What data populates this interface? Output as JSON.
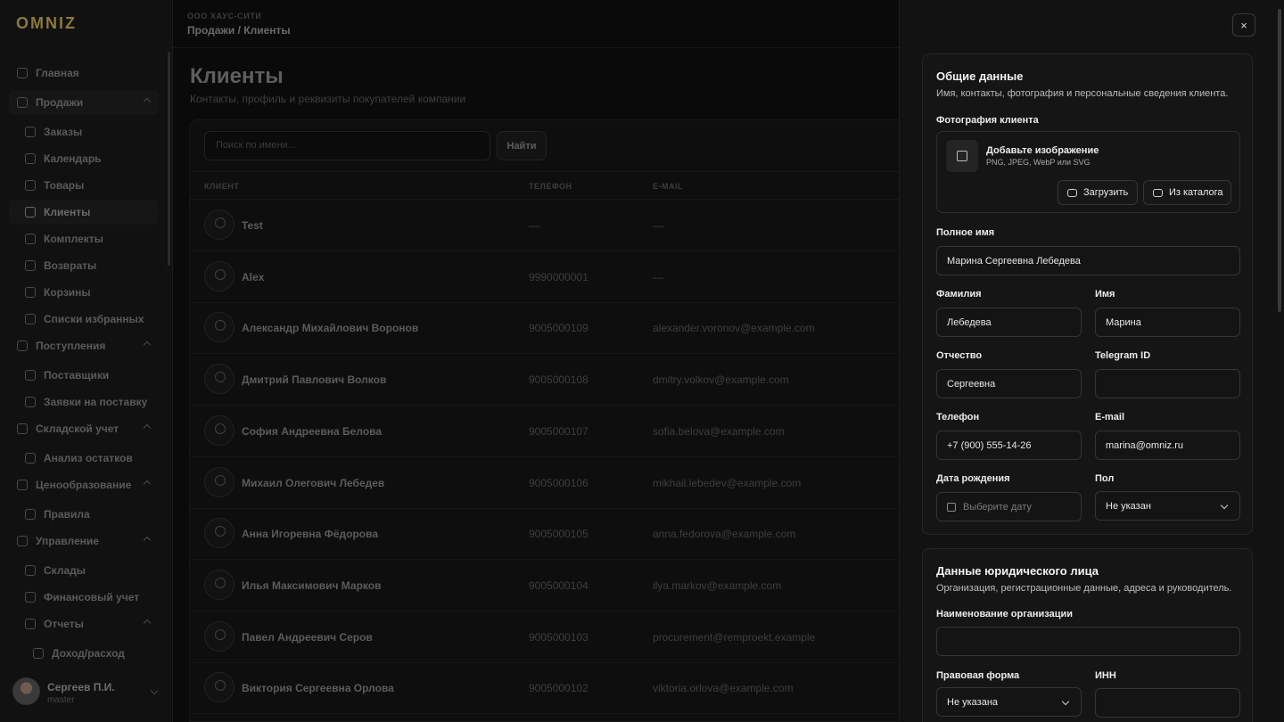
{
  "sidebar": {
    "logo": "OMNIZ",
    "items": [
      {
        "label": "Главная",
        "level": "top",
        "icon": "grid-icon"
      },
      {
        "label": "Продажи",
        "level": "top",
        "icon": "bag-icon",
        "expandable": true
      },
      {
        "label": "Заказы",
        "level": "sub",
        "icon": "clipboard-icon"
      },
      {
        "label": "Календарь",
        "level": "sub",
        "icon": "calendar-icon"
      },
      {
        "label": "Товары",
        "level": "sub",
        "icon": "box-icon"
      },
      {
        "label": "Клиенты",
        "level": "sub",
        "icon": "user-icon",
        "active": true
      },
      {
        "label": "Комплекты",
        "level": "sub",
        "icon": "layers-icon"
      },
      {
        "label": "Возвраты",
        "level": "sub",
        "icon": "return-icon"
      },
      {
        "label": "Корзины",
        "level": "sub",
        "icon": "cart-icon"
      },
      {
        "label": "Списки избранных",
        "level": "sub",
        "icon": "heart-icon"
      },
      {
        "label": "Поступления",
        "level": "top",
        "icon": "package-icon",
        "expandable": true
      },
      {
        "label": "Поставщики",
        "level": "sub",
        "icon": "truck-icon"
      },
      {
        "label": "Заявки на поставку",
        "level": "sub",
        "icon": "inbox-icon"
      },
      {
        "label": "Складской учет",
        "level": "top",
        "icon": "warehouse-icon",
        "expandable": true
      },
      {
        "label": "Анализ остатков",
        "level": "sub",
        "icon": "chart-icon"
      },
      {
        "label": "Ценообразование",
        "level": "top",
        "icon": "tag-icon",
        "expandable": true
      },
      {
        "label": "Правила",
        "level": "sub",
        "icon": "tag-icon"
      },
      {
        "label": "Управление",
        "level": "top",
        "icon": "building-icon",
        "expandable": true
      },
      {
        "label": "Склады",
        "level": "sub",
        "icon": "folder-icon"
      },
      {
        "label": "Финансовый учет",
        "level": "sub",
        "icon": "wallet-icon"
      },
      {
        "label": "Отчеты",
        "level": "sub",
        "icon": "bar-chart-icon",
        "expandable": true
      },
      {
        "label": "Доход/расход",
        "level": "sub2",
        "icon": "receipt-icon"
      }
    ],
    "user": {
      "name": "Сергеев П.И.",
      "role": "master"
    }
  },
  "header": {
    "company": "ООО ХАУС-СИТИ",
    "breadcrumb": "Продажи / Клиенты"
  },
  "page": {
    "title": "Клиенты",
    "subtitle": "Контакты, профиль и реквизиты покупателей компании"
  },
  "search": {
    "placeholder": "Поиск по имени...",
    "button": "Найти"
  },
  "table": {
    "columns": [
      "КЛИЕНТ",
      "ТЕЛЕФОН",
      "E-MAIL"
    ],
    "rows": [
      {
        "name": "Test",
        "phone": "—",
        "email": "—"
      },
      {
        "name": "Alex",
        "phone": "9990000001",
        "email": "—"
      },
      {
        "name": "Александр Михайлович Воронов",
        "phone": "9005000109",
        "email": "alexander.voronov@example.com"
      },
      {
        "name": "Дмитрий Павлович Волков",
        "phone": "9005000108",
        "email": "dmitry.volkov@example.com"
      },
      {
        "name": "София Андреевна Белова",
        "phone": "9005000107",
        "email": "sofia.belova@example.com"
      },
      {
        "name": "Михаил Олегович Лебедев",
        "phone": "9005000106",
        "email": "mikhail.lebedev@example.com"
      },
      {
        "name": "Анна Игоревна Фёдорова",
        "phone": "9005000105",
        "email": "anna.fedorova@example.com"
      },
      {
        "name": "Илья Максимович Марков",
        "phone": "9005000104",
        "email": "ilya.markov@example.com"
      },
      {
        "name": "Павел Андреевич Серов",
        "phone": "9005000103",
        "email": "procurement@remproekt.example"
      },
      {
        "name": "Виктория Сергеевна Орлова",
        "phone": "9005000102",
        "email": "viktoria.orlova@example.com"
      }
    ]
  },
  "drawer": {
    "close": "×",
    "general": {
      "title": "Общие данные",
      "subtitle": "Имя, контакты, фотография и персональные сведения клиента.",
      "photo_label": "Фотография клиента",
      "add_image": "Добавьте изображение",
      "formats": "PNG, JPEG, WebP или SVG",
      "upload": "Загрузить",
      "from_catalog": "Из каталога",
      "full_name_label": "Полное имя",
      "full_name": "Марина Сергеевна Лебедева",
      "last_name_label": "Фамилия",
      "last_name": "Лебедева",
      "first_name_label": "Имя",
      "first_name": "Марина",
      "patronymic_label": "Отчество",
      "patronymic": "Сергеевна",
      "telegram_label": "Telegram ID",
      "telegram": "",
      "phone_label": "Телефон",
      "phone": "+7 (900) 555-14-26",
      "email_label": "E-mail",
      "email": "marina@omniz.ru",
      "birth_label": "Дата рождения",
      "birth_placeholder": "Выберите дату",
      "gender_label": "Пол",
      "gender": "Не указан"
    },
    "legal": {
      "title": "Данные юридического лица",
      "subtitle": "Организация, регистрационные данные, адреса и руководитель.",
      "org_label": "Наименование организации",
      "org": "",
      "form_label": "Правовая форма",
      "form": "Не указана",
      "inn_label": "ИНН",
      "inn": ""
    }
  }
}
